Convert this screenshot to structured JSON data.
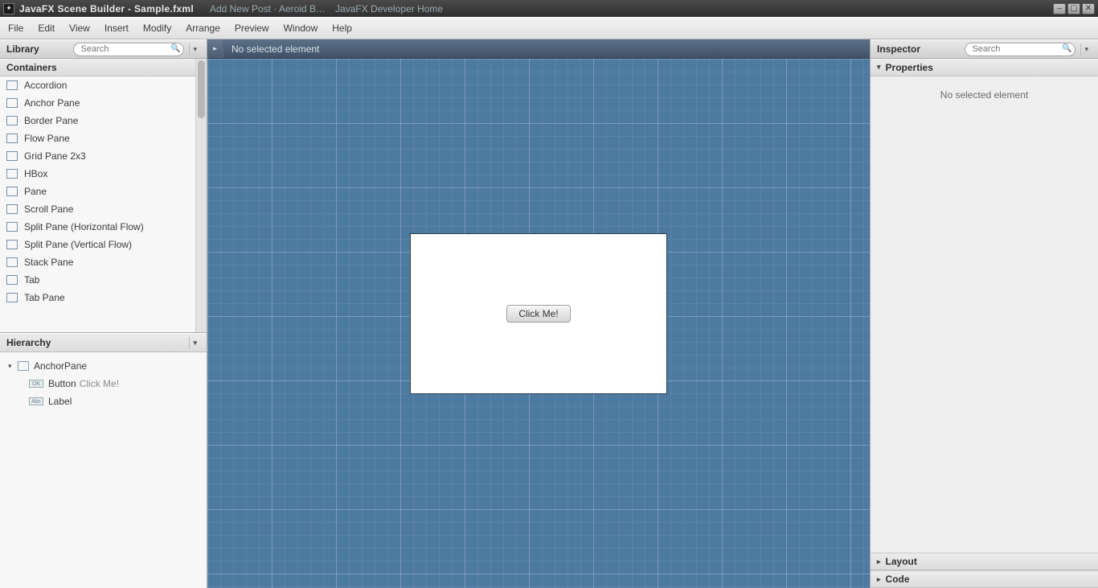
{
  "titlebar": {
    "app_title": "JavaFX Scene Builder - Sample.fxml",
    "bg_tabs": [
      "Add New Post · Aeroid B…",
      "JavaFX Developer Home"
    ]
  },
  "menubar": [
    "File",
    "Edit",
    "View",
    "Insert",
    "Modify",
    "Arrange",
    "Preview",
    "Window",
    "Help"
  ],
  "library": {
    "title": "Library",
    "search_placeholder": "Search",
    "section_title": "Containers",
    "items": [
      "Accordion",
      "Anchor Pane",
      "Border Pane",
      "Flow Pane",
      "Grid Pane 2x3",
      "HBox",
      "Pane",
      "Scroll Pane",
      "Split Pane (Horizontal Flow)",
      "Split Pane (Vertical Flow)",
      "Stack Pane",
      "Tab",
      "Tab Pane"
    ]
  },
  "hierarchy": {
    "title": "Hierarchy",
    "root": {
      "label": "AnchorPane"
    },
    "children": [
      {
        "icon": "OK",
        "label": "Button",
        "suffix": "Click Me!"
      },
      {
        "icon": "Abc",
        "label": "Label"
      }
    ]
  },
  "canvas": {
    "selection_message": "No selected element",
    "button_label": "Click Me!"
  },
  "inspector": {
    "title": "Inspector",
    "search_placeholder": "Search",
    "properties_title": "Properties",
    "empty_message": "No selected element",
    "layout_title": "Layout",
    "code_title": "Code"
  }
}
